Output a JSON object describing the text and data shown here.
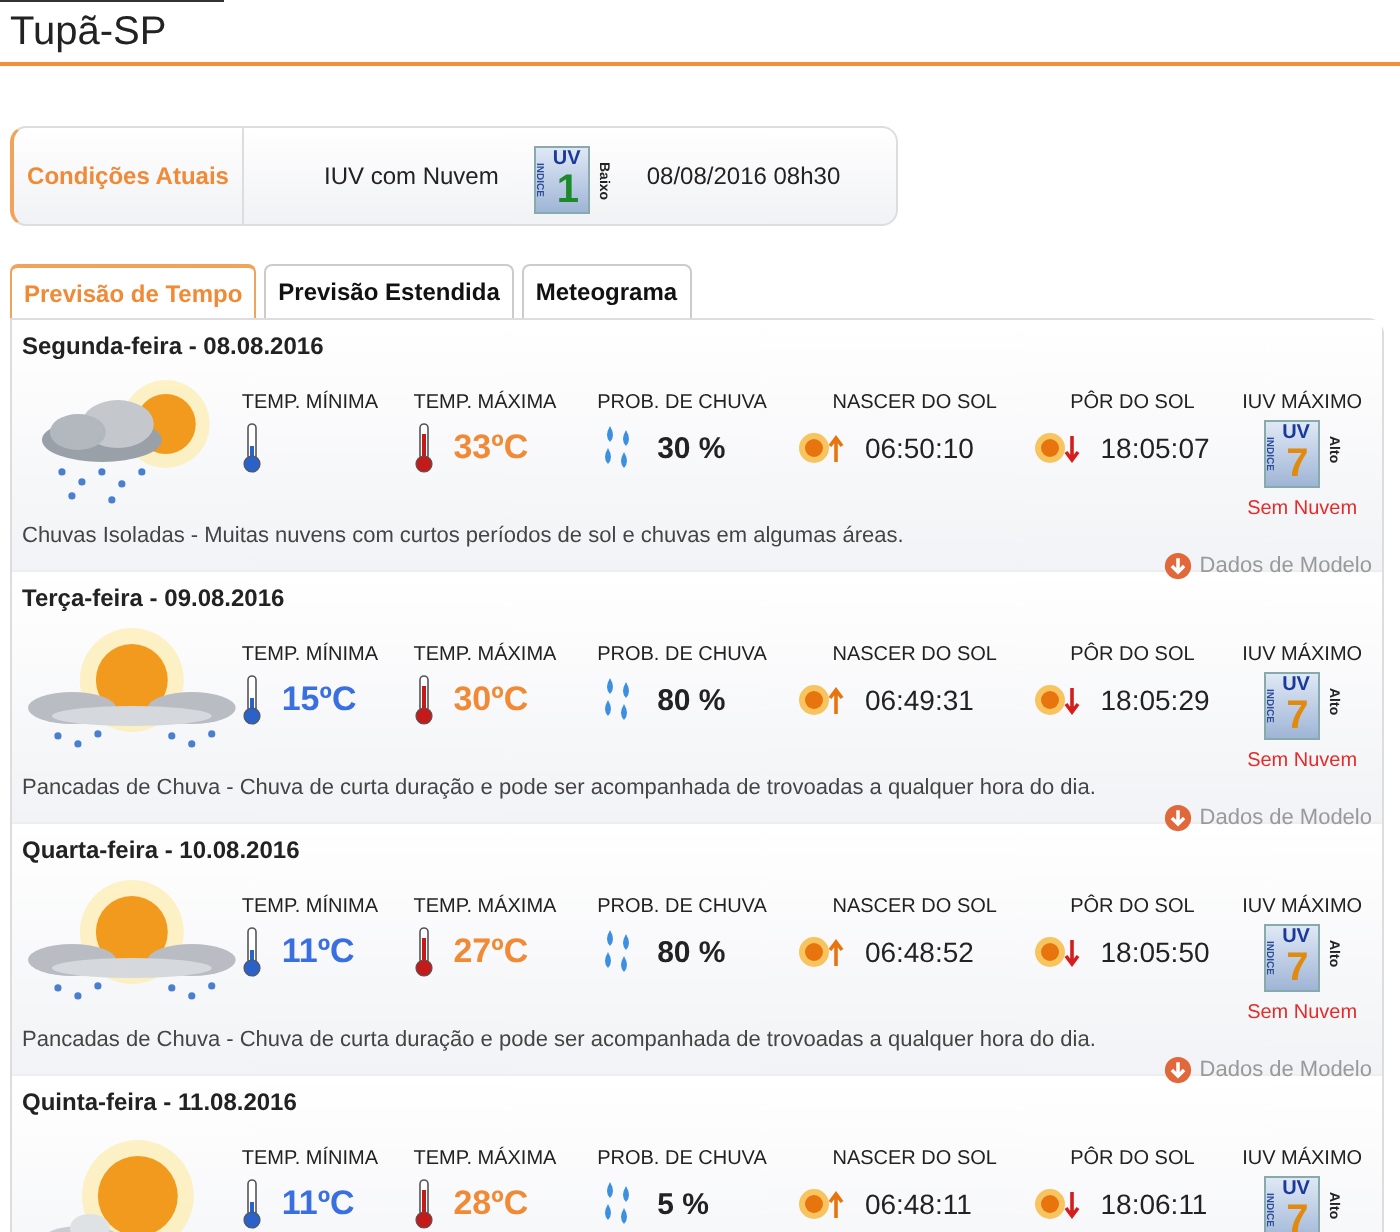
{
  "city": "Tupã-SP",
  "current": {
    "label": "Condições Atuais",
    "text": "IUV com Nuvem",
    "uv": {
      "index_word": "INDICE",
      "uv": "UV",
      "value": "1",
      "level": "Baixo"
    },
    "time": "08/08/2016 08h30"
  },
  "tabs": [
    {
      "label": "Previsão de Tempo",
      "selected": true
    },
    {
      "label": "Previsão Estendida",
      "selected": false
    },
    {
      "label": "Meteograma",
      "selected": false
    }
  ],
  "days": [
    {
      "date": "Segunda-feira - 08.08.2016",
      "kind": "cloud-sun-rain",
      "stats": [
        {
          "kind": "min",
          "label": "TEMP. MÍNIMA"
        },
        {
          "kind": "max",
          "label": "TEMP. MÁXIMA",
          "value": "33ºC"
        },
        {
          "kind": "rain",
          "label": "PROB. DE CHUVA",
          "value": "30 %"
        },
        {
          "kind": "sunrise",
          "label": "NASCER DO SOL",
          "value": "06:50:10"
        },
        {
          "kind": "sunset",
          "label": "PÔR DO SOL",
          "value": "18:05:07"
        }
      ],
      "uv": {
        "label": "IUV MÁXIMO",
        "index_word": "INDICE",
        "uv": "UV",
        "value": "7",
        "level": "Alto",
        "note": "Sem Nuvem"
      },
      "description": "Chuvas Isoladas - Muitas nuvens com curtos períodos de sol e chuvas em algumas áreas.",
      "link": "Dados de Modelo"
    },
    {
      "date": "Terça-feira - 09.08.2016",
      "kind": "sun-cloud-rain",
      "stats": [
        {
          "kind": "min",
          "label": "TEMP. MÍNIMA",
          "value": "15ºC"
        },
        {
          "kind": "max",
          "label": "TEMP. MÁXIMA",
          "value": "30ºC"
        },
        {
          "kind": "rain",
          "label": "PROB. DE CHUVA",
          "value": "80 %"
        },
        {
          "kind": "sunrise",
          "label": "NASCER DO SOL",
          "value": "06:49:31"
        },
        {
          "kind": "sunset",
          "label": "PÔR DO SOL",
          "value": "18:05:29"
        }
      ],
      "uv": {
        "label": "IUV MÁXIMO",
        "index_word": "INDICE",
        "uv": "UV",
        "value": "7",
        "level": "Alto",
        "note": "Sem Nuvem"
      },
      "description": "Pancadas de Chuva - Chuva de curta duração e pode ser acompanhada de trovoadas a qualquer hora do dia.",
      "link": "Dados de Modelo"
    },
    {
      "date": "Quarta-feira - 10.08.2016",
      "kind": "sun-cloud-rain",
      "stats": [
        {
          "kind": "min",
          "label": "TEMP. MÍNIMA",
          "value": "11ºC"
        },
        {
          "kind": "max",
          "label": "TEMP. MÁXIMA",
          "value": "27ºC"
        },
        {
          "kind": "rain",
          "label": "PROB. DE CHUVA",
          "value": "80 %"
        },
        {
          "kind": "sunrise",
          "label": "NASCER DO SOL",
          "value": "06:48:52"
        },
        {
          "kind": "sunset",
          "label": "PÔR DO SOL",
          "value": "18:05:50"
        }
      ],
      "uv": {
        "label": "IUV MÁXIMO",
        "index_word": "INDICE",
        "uv": "UV",
        "value": "7",
        "level": "Alto",
        "note": "Sem Nuvem"
      },
      "description": "Pancadas de Chuva - Chuva de curta duração e pode ser acompanhada de trovoadas a qualquer hora do dia.",
      "link": "Dados de Modelo"
    },
    {
      "date": "Quinta-feira - 11.08.2016",
      "kind": "sun-cloud",
      "stats": [
        {
          "kind": "min",
          "label": "TEMP. MÍNIMA",
          "value": "11ºC"
        },
        {
          "kind": "max",
          "label": "TEMP. MÁXIMA",
          "value": "28ºC"
        },
        {
          "kind": "rain",
          "label": "PROB. DE CHUVA",
          "value": "5 %"
        },
        {
          "kind": "sunrise",
          "label": "NASCER DO SOL",
          "value": "06:48:11"
        },
        {
          "kind": "sunset",
          "label": "PÔR DO SOL",
          "value": "18:06:11"
        }
      ],
      "uv": {
        "label": "IUV MÁXIMO",
        "index_word": "INDICE",
        "uv": "UV",
        "value": "7",
        "level": "Alto"
      }
    }
  ]
}
